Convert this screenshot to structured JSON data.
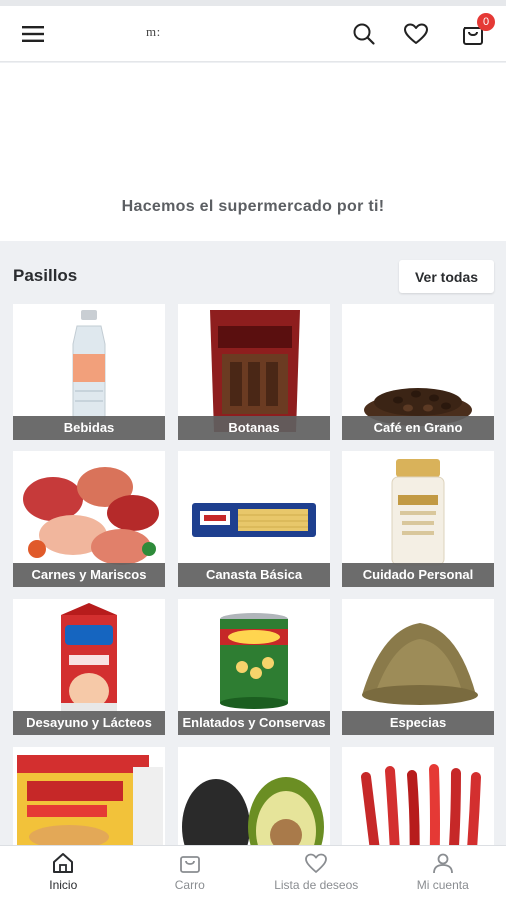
{
  "header": {
    "menu_icon": "hamburger-menu-icon",
    "logo_text": "m:",
    "search_icon": "search-icon",
    "wishlist_icon": "heart-icon",
    "cart_icon": "shopping-bag-icon",
    "cart_count": "0"
  },
  "hero": {
    "tagline": "Hacemos el supermercado por ti!"
  },
  "aisles": {
    "title": "Pasillos",
    "view_all_label": "Ver todas",
    "items": [
      {
        "label": "Bebidas"
      },
      {
        "label": "Botanas"
      },
      {
        "label": "Café en Grano"
      },
      {
        "label": "Carnes y Mariscos"
      },
      {
        "label": "Canasta Básica"
      },
      {
        "label": "Cuidado Personal"
      },
      {
        "label": "Desayuno y Lácteos"
      },
      {
        "label": "Enlatados y Conservas"
      },
      {
        "label": "Especias"
      },
      {
        "label": ""
      },
      {
        "label": ""
      },
      {
        "label": ""
      }
    ]
  },
  "bottom_nav": {
    "items": [
      {
        "label": "Inicio",
        "icon": "home-icon",
        "active": true
      },
      {
        "label": "Carro",
        "icon": "shopping-bag-icon",
        "active": false
      },
      {
        "label": "Lista de deseos",
        "icon": "heart-icon",
        "active": false
      },
      {
        "label": "Mi cuenta",
        "icon": "user-icon",
        "active": false
      }
    ]
  },
  "colors": {
    "badge": "#e53935",
    "label_overlay": "#606060",
    "background": "#eef0f3"
  }
}
